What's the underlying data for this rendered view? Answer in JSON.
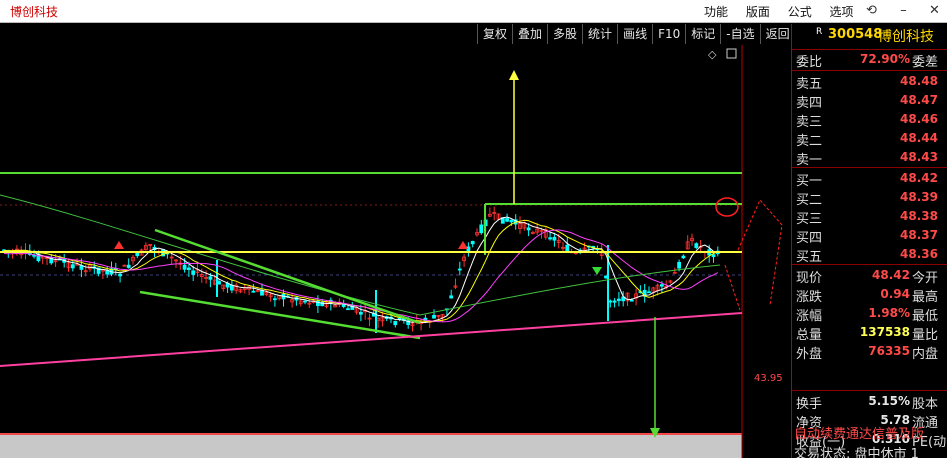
{
  "app": {
    "title": "博创科技"
  },
  "menu": [
    "功能",
    "版面",
    "公式",
    "选项"
  ],
  "toolbar": [
    "复权",
    "叠加",
    "多股",
    "统计",
    "画线",
    "F10",
    "标记",
    "-自选",
    "返回"
  ],
  "stock": {
    "r_tag": "R",
    "code": "300548",
    "name": "博创科技"
  },
  "quote": {
    "weibi_label": "委比",
    "weibi": "72.90%",
    "weicha_label": "委差",
    "asks": [
      {
        "label": "卖五",
        "price": "48.48"
      },
      {
        "label": "卖四",
        "price": "48.47"
      },
      {
        "label": "卖三",
        "price": "48.46"
      },
      {
        "label": "卖二",
        "price": "48.44"
      },
      {
        "label": "卖一",
        "price": "48.43"
      }
    ],
    "bids": [
      {
        "label": "买一",
        "price": "48.42"
      },
      {
        "label": "买二",
        "price": "48.39"
      },
      {
        "label": "买三",
        "price": "48.38"
      },
      {
        "label": "买四",
        "price": "48.37"
      },
      {
        "label": "买五",
        "price": "48.36"
      }
    ],
    "stats": [
      {
        "label": "现价",
        "value": "48.42",
        "label2": "今开"
      },
      {
        "label": "涨跌",
        "value": "0.94",
        "label2": "最高"
      },
      {
        "label": "涨幅",
        "value": "1.98%",
        "label2": "最低"
      },
      {
        "label": "总量",
        "value": "137538",
        "label2": "量比"
      },
      {
        "label": "外盘",
        "value": "76335",
        "label2": "内盘"
      }
    ],
    "stats2": [
      {
        "label": "换手",
        "value": "5.15%",
        "label2": "股本"
      },
      {
        "label": "净资",
        "value": "5.78",
        "label2": "流通"
      },
      {
        "label": "收益(一)",
        "value": "0.310",
        "label2": "PE(动"
      }
    ]
  },
  "ticker_text": "自动续费通达信普及版",
  "status_text": "交易状态: 盘中休市 1",
  "chart_data": {
    "type": "candlestick",
    "price_axis_label": "43.95",
    "colors": {
      "up": "#ff3030",
      "down": "#00ffff",
      "resistance": "#55dd33",
      "support": "#ffff40",
      "trend_up": "#ff40a0",
      "ma5": "#ffffff",
      "ma10": "#ffff00",
      "ma20": "#ff40ff",
      "ma60": "#40c040"
    }
  }
}
